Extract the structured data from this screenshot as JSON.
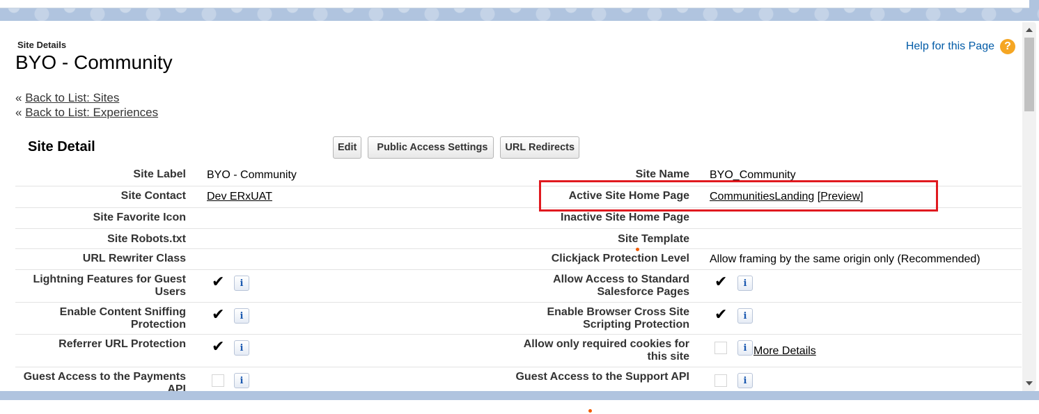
{
  "header": {
    "subtitle": "Site Details",
    "title": "BYO - Community",
    "help_label": "Help for this Page",
    "help_icon": "question-icon"
  },
  "back_links": [
    {
      "prefix": "«",
      "label": "Back to List: Sites"
    },
    {
      "prefix": "«",
      "label": "Back to List: Experiences"
    }
  ],
  "section": {
    "title": "Site Detail",
    "buttons": {
      "edit": "Edit",
      "public_access": "Public Access Settings",
      "url_redirects": "URL Redirects"
    }
  },
  "fields": {
    "site_label": {
      "label": "Site Label",
      "value": "BYO - Community"
    },
    "site_name": {
      "label": "Site Name",
      "value": "BYO_Community"
    },
    "site_contact": {
      "label": "Site Contact",
      "value": "Dev ERxUAT"
    },
    "active_home": {
      "label": "Active Site Home Page",
      "value": "CommunitiesLanding",
      "preview": "[Preview]"
    },
    "favorite_icon": {
      "label": "Site Favorite Icon"
    },
    "inactive_home": {
      "label": "Inactive Site Home Page"
    },
    "robots": {
      "label": "Site Robots.txt"
    },
    "template": {
      "label": "Site Template"
    },
    "url_rewriter": {
      "label": "URL Rewriter Class"
    },
    "clickjack": {
      "label": "Clickjack Protection Level",
      "value": "Allow framing by the same origin only (Recommended)"
    },
    "lightning_guest": {
      "label": "Lightning Features for Guest Users",
      "checked": true
    },
    "allow_standard": {
      "label": "Allow Access to Standard Salesforce Pages",
      "checked": true
    },
    "content_sniffing": {
      "label": "Enable Content Sniffing Protection",
      "checked": true
    },
    "xss": {
      "label": "Enable Browser Cross Site Scripting Protection",
      "checked": true
    },
    "referrer": {
      "label": "Referrer URL Protection",
      "checked": true
    },
    "required_cookies": {
      "label": "Allow only required cookies for this site",
      "checked": false,
      "more": "More Details"
    },
    "payments_api": {
      "label": "Guest Access to the Payments API",
      "checked": false
    },
    "support_api": {
      "label": "Guest Access to the Support API",
      "checked": false
    }
  },
  "info_icon_glyph": "i",
  "check_glyph": "✔"
}
